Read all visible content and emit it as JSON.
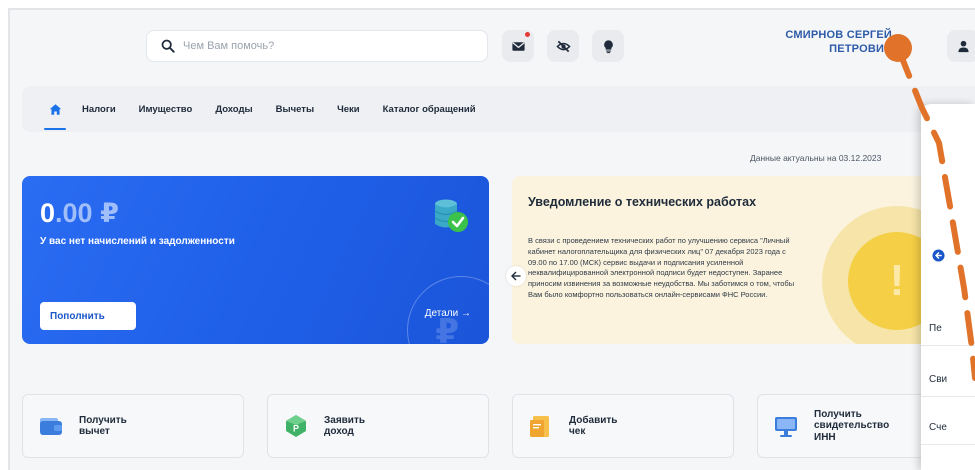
{
  "header": {
    "search_placeholder": "Чем Вам помочь?",
    "user_name_line1": "СМИРНОВ СЕРГЕЙ",
    "user_name_line2": "ПЕТРОВИЧ",
    "icons": [
      "search-icon",
      "mail-icon",
      "eye-off-icon",
      "lightbulb-icon",
      "user-icon"
    ]
  },
  "nav": {
    "items": [
      "Налоги",
      "Имущество",
      "Доходы",
      "Вычеты",
      "Чеки",
      "Каталог обращений"
    ]
  },
  "actual_date": "Данные актуальны на 03.12.2023",
  "balance": {
    "amount_int": "0",
    "amount_frac": ".00",
    "currency": "₽",
    "status": "У вас нет начислений и задолженности",
    "topup_label": "Пополнить",
    "details_label": "Детали →"
  },
  "notice": {
    "title": "Уведомление о технических работах",
    "text": "В связи с проведением технических работ по улучшению сервиса \"Личный кабинет налогоплательщика для физических лиц\" 07 декабря 2023 года с 09.00 по 17.00 (МСК) сервис выдачи и подписания усиленной неквалифицированной электронной подписи будет недоступен. Заранее приносим извинения за возможные неудобства. Мы заботимся о том, чтобы Вам было комфортно пользоваться онлайн-сервисами ФНС России."
  },
  "tiles": [
    {
      "line1": "Получить",
      "line2": "вычет",
      "line3": ""
    },
    {
      "line1": "Заявить",
      "line2": "доход",
      "line3": ""
    },
    {
      "line1": "Добавить",
      "line2": "чек",
      "line3": ""
    },
    {
      "line1": "Получить",
      "line2": "свидетельство",
      "line3": "ИНН"
    }
  ],
  "side_panel": {
    "rows": [
      "Пе",
      "Сви",
      "Сче"
    ]
  },
  "colors": {
    "accent": "#1a73e8",
    "balance_bg": "#2263ee",
    "notice_bg": "#fbf3dd",
    "user_name": "#2d5ba8",
    "annotation": "#e0722a"
  }
}
